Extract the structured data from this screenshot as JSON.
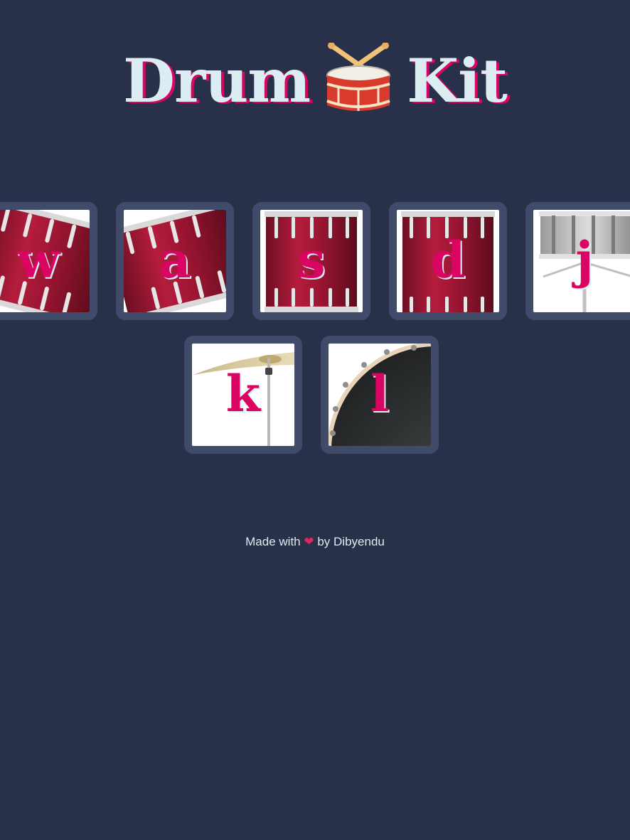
{
  "header": {
    "title_left": "Drum",
    "title_icon": "drum-with-sticks-icon",
    "title_right": "Kit"
  },
  "keys": [
    {
      "letter": "w",
      "image": "tom-1-drum"
    },
    {
      "letter": "a",
      "image": "tom-2-drum"
    },
    {
      "letter": "s",
      "image": "tom-3-drum"
    },
    {
      "letter": "d",
      "image": "tom-4-drum"
    },
    {
      "letter": "j",
      "image": "snare-drum"
    },
    {
      "letter": "k",
      "image": "crash-cymbal"
    },
    {
      "letter": "l",
      "image": "kick-drum"
    }
  ],
  "footer": {
    "prefix": "Made with",
    "heart": "❤",
    "suffix": "by Dibyendu"
  },
  "colors": {
    "background": "#283149",
    "button_border": "#404B69",
    "accent": "#DA0463",
    "text": "#DBEDF3"
  }
}
